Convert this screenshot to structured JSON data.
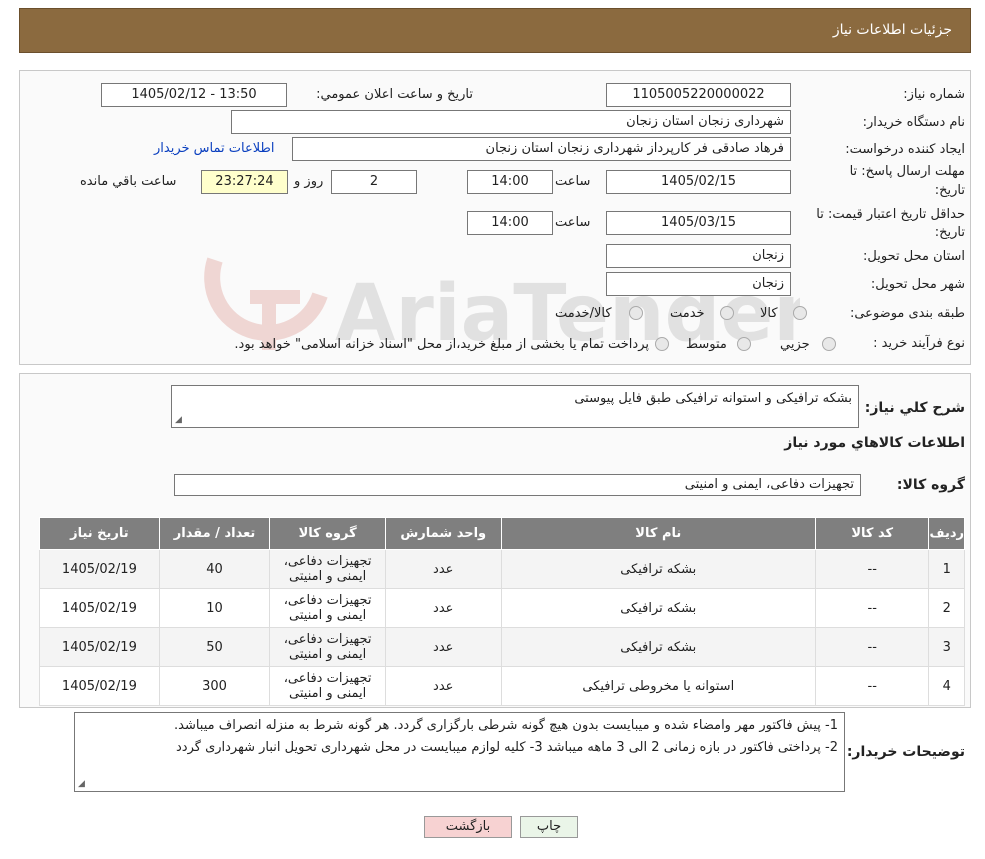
{
  "header": {
    "title": "جزئیات اطلاعات نیاز"
  },
  "form": {
    "need_number_label": "شماره نیاز:",
    "need_number": "1105005220000022",
    "announce_label": "تاریخ و ساعت اعلان عمومي:",
    "announce_value": "1405/02/12 - 13:50",
    "buyer_org_label": "نام دستگاه خريدار:",
    "buyer_org": "شهرداری زنجان استان زنجان",
    "creator_label": "ايجاد کننده درخواست:",
    "creator": "فرهاد صادقی فر کارپرداز شهرداری زنجان استان زنجان",
    "contact_link": "اطلاعات تماس خريدار",
    "deadline_label_1": "مهلت ارسال پاسخ: تا",
    "deadline_label_2": "تاریخ:",
    "deadline_date": "1405/02/15",
    "time_label": "ساعت",
    "deadline_time": "14:00",
    "days_value": "2",
    "days_label": "روز و",
    "remaining_time": "23:27:24",
    "remaining_label": "ساعت باقي مانده",
    "validity_label_1": "حداقل تاريخ اعتبار قيمت: تا",
    "validity_label_2": "تاريخ:",
    "validity_date": "1405/03/15",
    "validity_time": "14:00",
    "province_label": "استان محل تحويل:",
    "province": "زنجان",
    "city_label": "شهر محل تحويل:",
    "city": "زنجان",
    "category_label": "طبقه بندی موضوعی:",
    "category_options": [
      "کالا",
      "خدمت",
      "کالا/خدمت"
    ],
    "process_label": "نوع فرآيند خريد :",
    "process_options": [
      "جزيي",
      "متوسط"
    ],
    "process_note": "پرداخت تمام يا بخشی از مبلغ خريد،از محل \"اسناد خزانه اسلامی\" خواهد بود."
  },
  "description": {
    "label": "شرح کلي نياز:",
    "value": "بشکه ترافیکی و استوانه ترافیکی طبق فایل پیوستی"
  },
  "goods_section": {
    "title": "اطلاعات کالاهاي مورد نياز",
    "group_label": "گروه کالا:",
    "group_value": "تجهیزات دفاعی، ایمنی و امنیتی"
  },
  "table": {
    "headers": [
      "رديف",
      "کد کالا",
      "نام کالا",
      "واحد شمارش",
      "گروه کالا",
      "تعداد / مقدار",
      "تاريخ نياز"
    ],
    "rows": [
      {
        "index": "1",
        "code": "--",
        "name": "بشکه ترافیکی",
        "unit": "عدد",
        "group_1": "تجهیزات دفاعی،",
        "group_2": "ایمنی و امنیتی",
        "qty": "40",
        "date": "1405/02/19"
      },
      {
        "index": "2",
        "code": "--",
        "name": "بشکه ترافیکی",
        "unit": "عدد",
        "group_1": "تجهیزات دفاعی،",
        "group_2": "ایمنی و امنیتی",
        "qty": "10",
        "date": "1405/02/19"
      },
      {
        "index": "3",
        "code": "--",
        "name": "بشکه ترافیکی",
        "unit": "عدد",
        "group_1": "تجهیزات دفاعی،",
        "group_2": "ایمنی و امنیتی",
        "qty": "50",
        "date": "1405/02/19"
      },
      {
        "index": "4",
        "code": "--",
        "name": "استوانه یا مخروطی ترافیکی",
        "unit": "عدد",
        "group_1": "تجهیزات دفاعی،",
        "group_2": "ایمنی و امنیتی",
        "qty": "300",
        "date": "1405/02/19"
      }
    ]
  },
  "buyer_notes": {
    "label": "توضيحات خريدار:",
    "line_1": "1- پیش فاکتور مهر وامضاء شده و میبایست بدون هیچ گونه شرطی بارگزاری گردد. هر گونه شرط به منزله انصراف میباشد.",
    "line_2": "2- پرداختی فاکتور در بازه زمانی 2 الی 3 ماهه میباشد  3- کلیه لوازم میبایست در محل شهرداری تحویل انبار شهرداری گردد"
  },
  "buttons": {
    "print": "چاپ",
    "back": "بازگشت"
  },
  "colors": {
    "header_bg": "#8b6a3f",
    "table_header_bg": "#7f7f7f",
    "back_button_bg": "#f7d2d2",
    "print_button_bg": "#eaf5e8",
    "link": "#0a3fbf"
  }
}
